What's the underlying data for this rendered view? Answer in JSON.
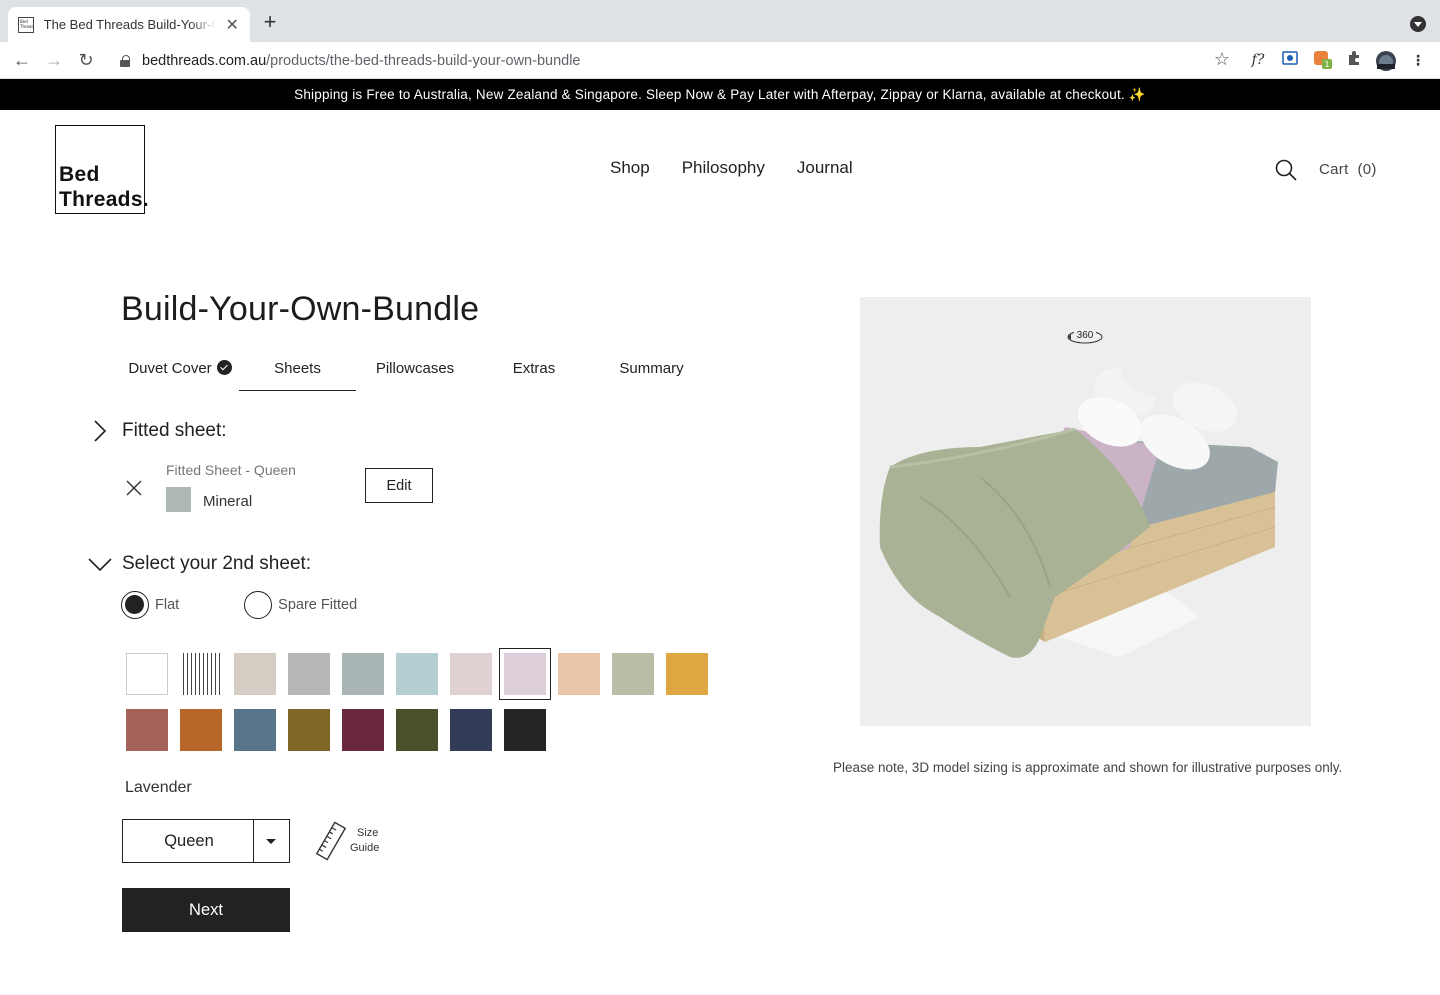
{
  "browser": {
    "tab_title": "The Bed Threads Build-Your-Own-Bundle",
    "favicon_text": "Bed Threads",
    "url_host": "bedthreads.com.au",
    "url_path": "/products/the-bed-threads-build-your-own-bundle",
    "extension_badge": "1"
  },
  "announcement": "Shipping is Free to Australia, New Zealand & Singapore. Sleep Now & Pay Later with Afterpay, Zippay or Klarna, available at checkout. ✨",
  "header": {
    "logo_line1": "Bed",
    "logo_line2": "Threads.",
    "nav": [
      "Shop",
      "Philosophy",
      "Journal"
    ],
    "cart_label": "Cart",
    "cart_count": "(0)"
  },
  "builder": {
    "title": "Build-Your-Own-Bundle",
    "steps": [
      {
        "label": "Duvet Cover",
        "completed": true
      },
      {
        "label": "Sheets",
        "active": true
      },
      {
        "label": "Pillowcases"
      },
      {
        "label": "Extras"
      },
      {
        "label": "Summary"
      }
    ],
    "fitted": {
      "heading": "Fitted sheet:",
      "item_name": "Fitted Sheet - Queen",
      "color_name": "Mineral",
      "color_hex": "#aeb8b7",
      "edit_label": "Edit"
    },
    "second": {
      "heading": "Select your 2nd sheet:",
      "options": [
        {
          "label": "Flat",
          "checked": true
        },
        {
          "label": "Spare Fitted",
          "checked": false
        }
      ],
      "swatches": [
        {
          "color": "#ffffff",
          "border": true
        },
        {
          "color": "stripe"
        },
        {
          "color": "#d5cdc4"
        },
        {
          "color": "#b8b7b8"
        },
        {
          "color": "#a9b5b5"
        },
        {
          "color": "#b5ced2"
        },
        {
          "color": "#e0d1d3"
        },
        {
          "color": "#dccfda",
          "selected": true
        },
        {
          "color": "#e9c5aa"
        },
        {
          "color": "#b8bfa6"
        },
        {
          "color": "#dfa741"
        },
        {
          "color": "#a3625a"
        },
        {
          "color": "#b8662a"
        },
        {
          "color": "#587589"
        },
        {
          "color": "#7d6627"
        },
        {
          "color": "#6a283f"
        },
        {
          "color": "#4a5029"
        },
        {
          "color": "#333c56"
        },
        {
          "color": "#252528"
        }
      ],
      "selected_color_name": "Lavender",
      "size_value": "Queen",
      "size_guide_line1": "Size",
      "size_guide_line2": "Guide",
      "next_label": "Next"
    }
  },
  "viewer": {
    "rotate_label": "360",
    "note": "Please note, 3D model sizing is approximate and shown for illustrative purposes only."
  }
}
